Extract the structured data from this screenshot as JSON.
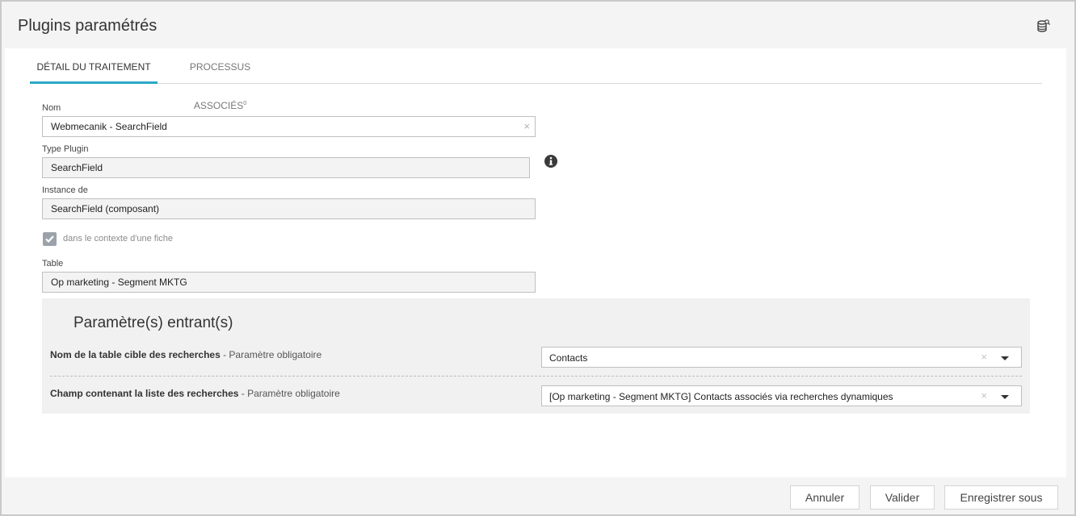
{
  "window": {
    "title": "Plugins paramétrés",
    "db_icon": "database-search-icon"
  },
  "tabs": [
    {
      "label": "DÉTAIL DU TRAITEMENT",
      "active": true
    },
    {
      "label": "PROCESSUS ASSOCIÉS",
      "count": "0",
      "active": false
    }
  ],
  "form": {
    "nom": {
      "label": "Nom",
      "value": "Webmecanik - SearchField",
      "clear": "×"
    },
    "type_plugin": {
      "label": "Type Plugin",
      "value": "SearchField"
    },
    "instance": {
      "label": "Instance de",
      "value": "SearchField (composant)"
    },
    "context_checkbox": {
      "label": "dans le contexte d'une fiche",
      "checked": true
    },
    "table": {
      "label": "Table",
      "value": "Op marketing - Segment MKTG"
    }
  },
  "params": {
    "title": "Paramètre(s) entrant(s)",
    "items": [
      {
        "label": "Nom de la table cible des recherches",
        "suffix": " - Paramètre obligatoire",
        "value": "Contacts",
        "clear": "×"
      },
      {
        "label": "Champ contenant la liste des recherches",
        "suffix": " - Paramètre obligatoire",
        "value": "[Op marketing - Segment MKTG] Contacts associés via recherches dynamiques",
        "clear": "×"
      }
    ]
  },
  "footer": {
    "cancel": "Annuler",
    "validate": "Valider",
    "save_as": "Enregistrer sous"
  },
  "colors": {
    "accent": "#2aa8c9",
    "panel": "#f1f1f1"
  }
}
